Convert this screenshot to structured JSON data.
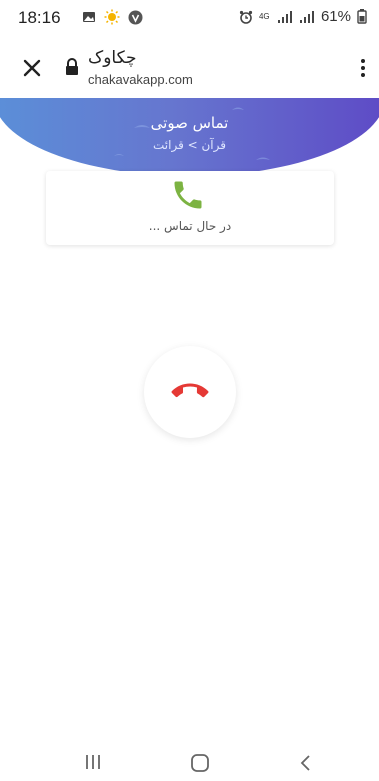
{
  "status_bar": {
    "time": "18:16",
    "battery": "61%",
    "network": "4G",
    "icons": [
      "gallery-icon",
      "weather-icon",
      "app-notification-icon",
      "alarm-icon",
      "network-4g-icon",
      "signal-icon",
      "signal-icon",
      "battery-icon"
    ]
  },
  "browser": {
    "title": "چکاوک",
    "url": "chakavakapp.com",
    "icons": [
      "close-icon",
      "lock-icon",
      "more-vert-icon"
    ]
  },
  "header": {
    "title": "تماس صوتی",
    "breadcrumb": "قرآن > قرائت",
    "gradient": [
      "#5b8fd8",
      "#6676cf",
      "#5e4bc6"
    ]
  },
  "call": {
    "status": "در حال تماس ...",
    "accent_color": "#7cb342",
    "hangup_color": "#e53935"
  },
  "nav": {
    "icons": [
      "recents-icon",
      "home-icon",
      "back-icon"
    ]
  }
}
